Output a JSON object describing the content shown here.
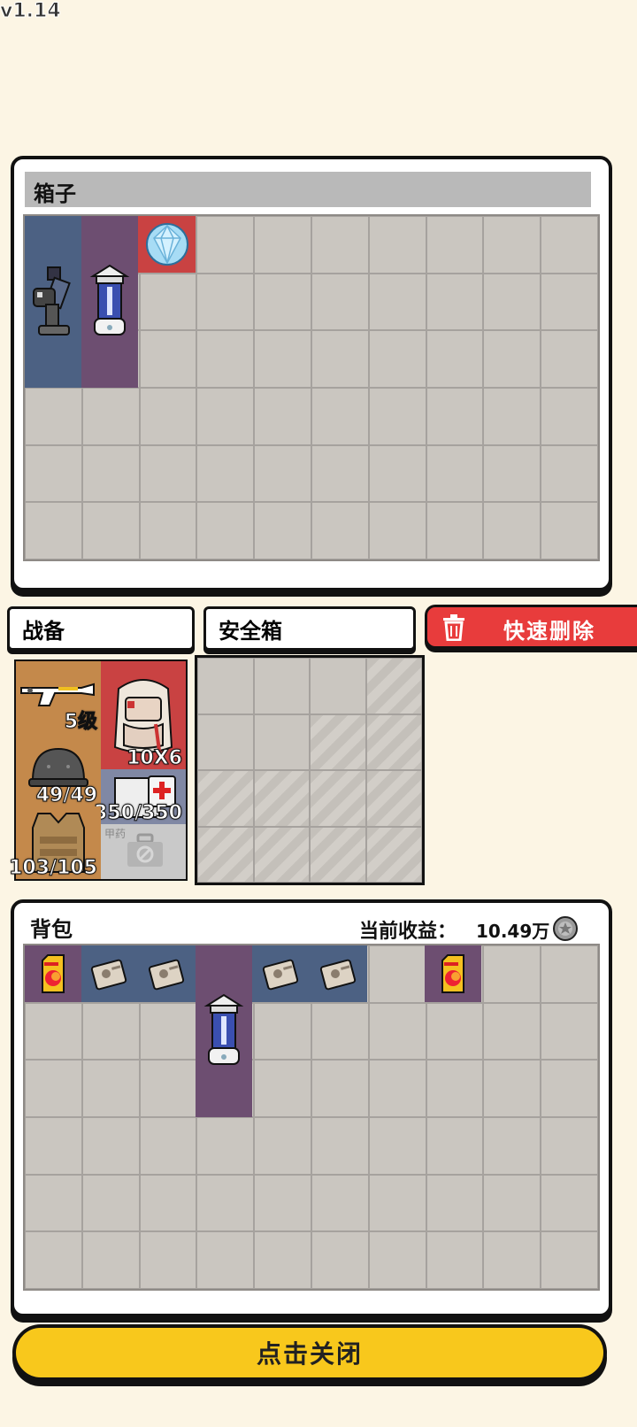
{
  "version": "v1.14",
  "box": {
    "title": "箱子"
  },
  "tabs": {
    "equipment": "战备",
    "safe_box": "安全箱"
  },
  "delete_button": {
    "label": "快速删除"
  },
  "equipment": {
    "weapon_level": "5级",
    "backpack_size": "10X6",
    "helmet": "49/49",
    "medkit": "350/350",
    "armor": "103/105",
    "armor_medkit_slot": "甲药"
  },
  "backpack": {
    "title": "背包",
    "earnings_label": "当前收益：",
    "earnings_value": "10.49万"
  },
  "close_button": {
    "label": "点击关闭"
  },
  "colors": {
    "rarity_blue": "#4c6183",
    "rarity_purple": "#6d4e71",
    "rarity_red": "#c94242",
    "delete_red": "#e83c3c",
    "close_yellow": "#f8c81c"
  }
}
